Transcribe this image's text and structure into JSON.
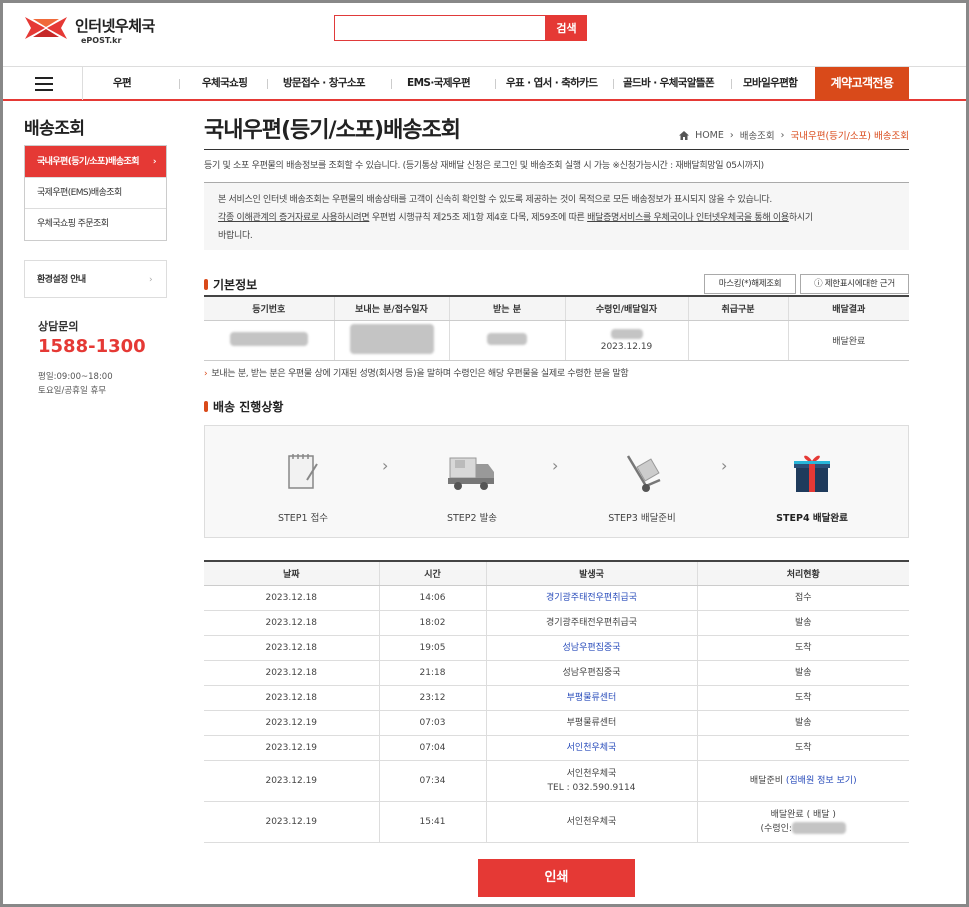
{
  "header": {
    "logo_title": "인터넷우체국",
    "logo_sub": "ePOST.kr",
    "search_placeholder": "",
    "search_button": "검색"
  },
  "nav": {
    "items": [
      "우편",
      "우체국쇼핑",
      "방문접수 · 창구소포",
      "EMS·국제우편",
      "우표 · 엽서 · 축하카드",
      "골드바 · 우체국알뜰폰",
      "모바일우편함"
    ],
    "cta": "계약고객전용"
  },
  "sidebar": {
    "title": "배송조회",
    "items": [
      {
        "label": "국내우편(등기/소포)배송조회",
        "active": true
      },
      {
        "label": "국제우편(EMS)배송조회",
        "active": false
      },
      {
        "label": "우체국쇼핑 주문조회",
        "active": false
      }
    ],
    "env_label": "환경설정 안내",
    "cs_title": "상담문의",
    "cs_number": "1588-1300",
    "cs_hours_1": "평일:09:00~18:00",
    "cs_hours_2": "토요일/공휴일 휴무"
  },
  "main": {
    "title": "국내우편(등기/소포)배송조회",
    "breadcrumb": [
      "HOME",
      "배송조회",
      "국내우편(등기/소포) 배송조회"
    ],
    "intro": "등기 및 소포 우편물의 배송정보를 조회할 수 있습니다. (등기통상 재배달 신청은 로그인 및 배송조회 실행 시 가능 ※신청가능시간 : 재배달희망일 05시까지)",
    "notice_1": "본 서비스인 인터넷 배송조회는 우편물의 배송상태를 고객이 신속히 확인할 수 있도록 제공하는 것이 목적으로 모든 배송정보가 표시되지 않을 수 있습니다.",
    "notice_2a": "각종 이해관계의 증거자료로 사용하시려면",
    "notice_2b": " 우편법 시행규칙 제25조 제1항 제4호 다목, 제59조에 따른 ",
    "notice_2c": "배달증명서비스를 우체국이나 인터넷우체국을 통해 이용",
    "notice_2d": "하시기",
    "notice_3": "바랍니다."
  },
  "basic_info": {
    "title": "기본정보",
    "masking_button": "마스킹(*)해제조회",
    "limit_button": "제한표시에대한 근거",
    "headers": [
      "등기번호",
      "보내는 분/접수일자",
      "받는 분",
      "수령인/배달일자",
      "취급구분",
      "배달결과"
    ],
    "delivery_date": "2023.12.19",
    "result": "배달완료",
    "note": "보내는 분, 받는 분은 우편물 상에 기재된 성명(회사명 등)을 말하며 수령인은 해당 우편물을 실제로 수령한 분을 말함"
  },
  "progress": {
    "title": "배송 진행상황",
    "steps": [
      "STEP1 접수",
      "STEP2 발송",
      "STEP3 배달준비",
      "STEP4 배달완료"
    ],
    "current_step": 4
  },
  "history": {
    "headers": [
      "날짜",
      "시간",
      "발생국",
      "처리현황"
    ],
    "rows": [
      {
        "date": "2023.12.18",
        "time": "14:06",
        "office": "경기광주태전우편취급국",
        "office_link": true,
        "status": "접수"
      },
      {
        "date": "2023.12.18",
        "time": "18:02",
        "office": "경기광주태전우편취급국",
        "office_link": false,
        "status": "발송"
      },
      {
        "date": "2023.12.18",
        "time": "19:05",
        "office": "성남우편집중국",
        "office_link": true,
        "status": "도착"
      },
      {
        "date": "2023.12.18",
        "time": "21:18",
        "office": "성남우편집중국",
        "office_link": false,
        "status": "발송"
      },
      {
        "date": "2023.12.18",
        "time": "23:12",
        "office": "부평물류센터",
        "office_link": true,
        "status": "도착"
      },
      {
        "date": "2023.12.19",
        "time": "07:03",
        "office": "부평물류센터",
        "office_link": false,
        "status": "발송"
      },
      {
        "date": "2023.12.19",
        "time": "07:04",
        "office": "서인천우체국",
        "office_link": true,
        "status": "도착"
      }
    ],
    "row8": {
      "date": "2023.12.19",
      "time": "07:34",
      "office": "서인천우체국",
      "tel": "TEL : 032.590.9114",
      "status": "배달준비",
      "status_link": "(집배원 정보 보기)"
    },
    "row9": {
      "date": "2023.12.19",
      "time": "15:41",
      "office": "서인천우체국",
      "status": "배달완료 ( 배달 )",
      "receiver_label": "(수령인:"
    }
  },
  "print_button": "인쇄",
  "colors": {
    "accent": "#e53935",
    "cta": "#d94a1a",
    "link": "#2a4dbb"
  }
}
